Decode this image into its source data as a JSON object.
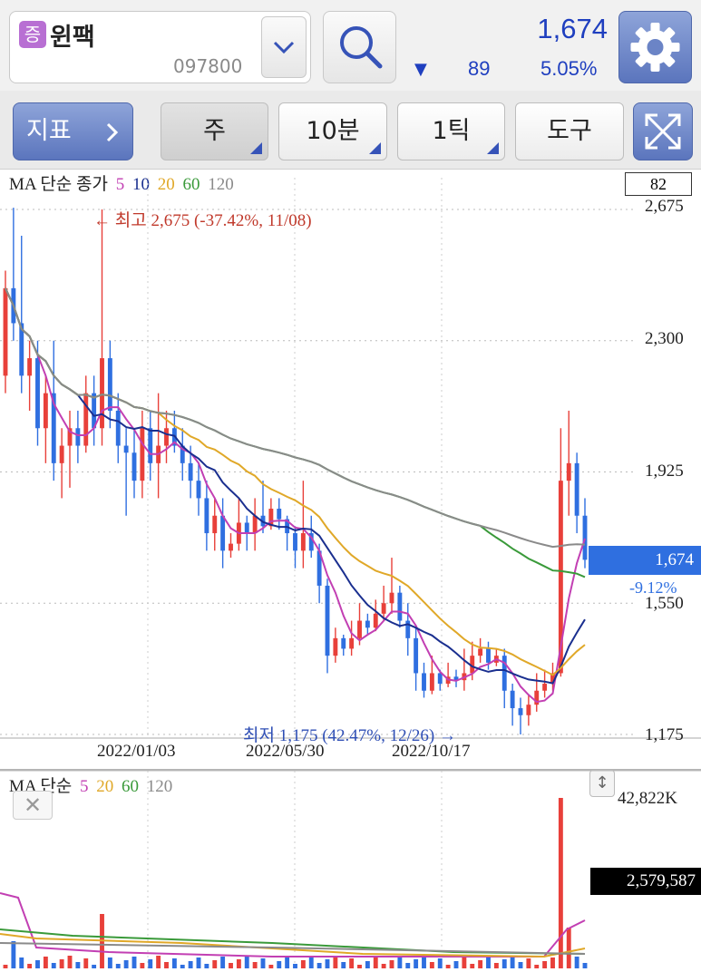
{
  "header": {
    "badge": "증",
    "stock_name": "윈팩",
    "stock_code": "097800",
    "price": "1,674",
    "change_arrow": "▼",
    "change": "89",
    "change_pct": "5.05%"
  },
  "toolbar": {
    "indicator_label": "지표",
    "indicator_chevron": "›",
    "period_week": "주",
    "period_10min": "10분",
    "period_tick": "1틱",
    "tools": "도구"
  },
  "price_chart": {
    "legend_prefix": "MA 단순 종가",
    "ma_periods": [
      "5",
      "10",
      "20",
      "60",
      "120"
    ],
    "ma_colors": [
      "#c23fb3",
      "#1a2f8f",
      "#e0a828",
      "#3a9a3a",
      "#8a8a8a"
    ],
    "count_box": "82",
    "y_ticks": [
      "2,675",
      "2,300",
      "1,925",
      "1,550",
      "1,175"
    ],
    "x_ticks": [
      "2022/01/03",
      "2022/05/30",
      "2022/10/17"
    ],
    "current_price": "1,674",
    "current_pct": "-9.12%",
    "high_annotation": "← 최고 2,675 (-37.42%, 11/08)",
    "low_annotation": "최저 1,175 (42.47%, 12/26) →",
    "up_color": "#e8403a",
    "down_color": "#2f6fe0"
  },
  "volume_chart": {
    "legend_prefix": "MA 단순",
    "ma_periods": [
      "5",
      "20",
      "60",
      "120"
    ],
    "ma_colors": [
      "#c23fb3",
      "#e0a828",
      "#3a9a3a",
      "#8a8a8a"
    ],
    "max_label": "42,822K",
    "current_volume": "2,579,587",
    "close_glyph": "✕",
    "resize_glyph": "↕"
  },
  "chart_data": {
    "type": "candlestick",
    "ylim": [
      1175,
      2675
    ],
    "candles": [
      [
        2200,
        2450,
        2150,
        2500
      ],
      [
        2450,
        2350,
        2300,
        2680
      ],
      [
        2350,
        2200,
        2150,
        2600
      ],
      [
        2200,
        2250,
        2100,
        2300
      ],
      [
        2250,
        2050,
        2000,
        2300
      ],
      [
        2050,
        2150,
        1950,
        2200
      ],
      [
        2150,
        1950,
        1900,
        2300
      ],
      [
        1950,
        2000,
        1850,
        2050
      ],
      [
        2000,
        2050,
        1880,
        2100
      ],
      [
        2050,
        2000,
        1950,
        2100
      ],
      [
        2000,
        2150,
        1980,
        2200
      ],
      [
        2150,
        2050,
        2000,
        2200
      ],
      [
        2050,
        2250,
        2000,
        2675
      ],
      [
        2250,
        2100,
        2050,
        2300
      ],
      [
        2100,
        2000,
        1950,
        2150
      ],
      [
        2000,
        1980,
        1800,
        2050
      ],
      [
        1980,
        1900,
        1850,
        2050
      ],
      [
        1900,
        2050,
        1850,
        2100
      ],
      [
        2050,
        1950,
        1900,
        2100
      ],
      [
        1950,
        2000,
        1850,
        2150
      ],
      [
        2000,
        2050,
        1950,
        2100
      ],
      [
        2050,
        2000,
        1980,
        2100
      ],
      [
        2000,
        1950,
        1900,
        2050
      ],
      [
        1950,
        1900,
        1850,
        2000
      ],
      [
        1900,
        1850,
        1800,
        1950
      ],
      [
        1850,
        1750,
        1700,
        1900
      ],
      [
        1750,
        1800,
        1700,
        1850
      ],
      [
        1800,
        1700,
        1650,
        1850
      ],
      [
        1700,
        1720,
        1680,
        1750
      ],
      [
        1720,
        1780,
        1700,
        1850
      ],
      [
        1780,
        1750,
        1700,
        1800
      ],
      [
        1750,
        1800,
        1700,
        1850
      ],
      [
        1800,
        1770,
        1750,
        1900
      ],
      [
        1770,
        1820,
        1760,
        1850
      ],
      [
        1820,
        1790,
        1760,
        1850
      ],
      [
        1790,
        1750,
        1700,
        1800
      ],
      [
        1750,
        1700,
        1650,
        1770
      ],
      [
        1700,
        1750,
        1650,
        1900
      ],
      [
        1750,
        1700,
        1680,
        1800
      ],
      [
        1700,
        1600,
        1550,
        1720
      ],
      [
        1600,
        1400,
        1350,
        1620
      ],
      [
        1400,
        1450,
        1380,
        1480
      ],
      [
        1450,
        1420,
        1400,
        1460
      ],
      [
        1420,
        1450,
        1400,
        1500
      ],
      [
        1450,
        1500,
        1430,
        1550
      ],
      [
        1500,
        1480,
        1460,
        1520
      ],
      [
        1480,
        1520,
        1470,
        1560
      ],
      [
        1520,
        1550,
        1500,
        1600
      ],
      [
        1550,
        1580,
        1520,
        1680
      ],
      [
        1580,
        1500,
        1480,
        1600
      ],
      [
        1500,
        1450,
        1400,
        1550
      ],
      [
        1450,
        1350,
        1300,
        1480
      ],
      [
        1350,
        1300,
        1280,
        1380
      ],
      [
        1300,
        1350,
        1290,
        1400
      ],
      [
        1350,
        1320,
        1300,
        1360
      ],
      [
        1320,
        1340,
        1310,
        1380
      ],
      [
        1340,
        1330,
        1310,
        1360
      ],
      [
        1330,
        1350,
        1300,
        1420
      ],
      [
        1350,
        1400,
        1330,
        1440
      ],
      [
        1400,
        1420,
        1380,
        1450
      ],
      [
        1420,
        1380,
        1360,
        1440
      ],
      [
        1380,
        1400,
        1370,
        1420
      ],
      [
        1400,
        1300,
        1250,
        1420
      ],
      [
        1300,
        1250,
        1200,
        1320
      ],
      [
        1250,
        1230,
        1175,
        1280
      ],
      [
        1230,
        1260,
        1200,
        1290
      ],
      [
        1260,
        1300,
        1240,
        1350
      ],
      [
        1300,
        1320,
        1280,
        1360
      ],
      [
        1320,
        1350,
        1300,
        1380
      ],
      [
        1350,
        1900,
        1340,
        2050
      ],
      [
        1900,
        1950,
        1800,
        2100
      ],
      [
        1950,
        1800,
        1750,
        1980
      ],
      [
        1800,
        1674,
        1650,
        1850
      ]
    ]
  }
}
